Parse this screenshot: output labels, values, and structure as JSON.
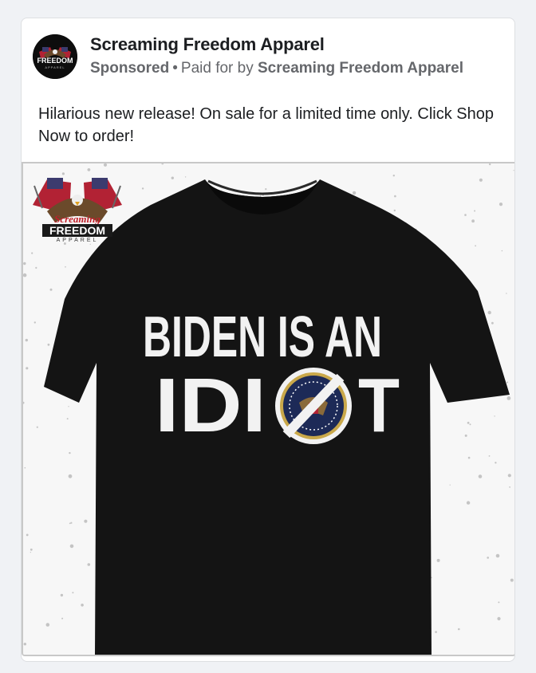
{
  "post": {
    "page_name": "Screaming Freedom Apparel",
    "sponsored_label": "Sponsored",
    "separator": "•",
    "paid_for_prefix": "Paid for by",
    "payer_name": "Screaming Freedom Apparel",
    "caption": "Hilarious new release! On sale for a limited time only. Click Shop Now to order!"
  },
  "avatar": {
    "logo_top": "FREEDOM",
    "logo_bottom": "APPAREL"
  },
  "product_image": {
    "logo_script": "Screaming",
    "logo_main": "FREEDOM",
    "logo_sub": "APPAREL",
    "shirt_line1": "BIDEN IS AN",
    "shirt_line2_left": "IDI",
    "shirt_line2_right": "T",
    "shirt_color": "#141414",
    "text_color": "#f2f2f2",
    "seal_color": "#1d2a57",
    "seal_rim": "#c9a84a"
  }
}
